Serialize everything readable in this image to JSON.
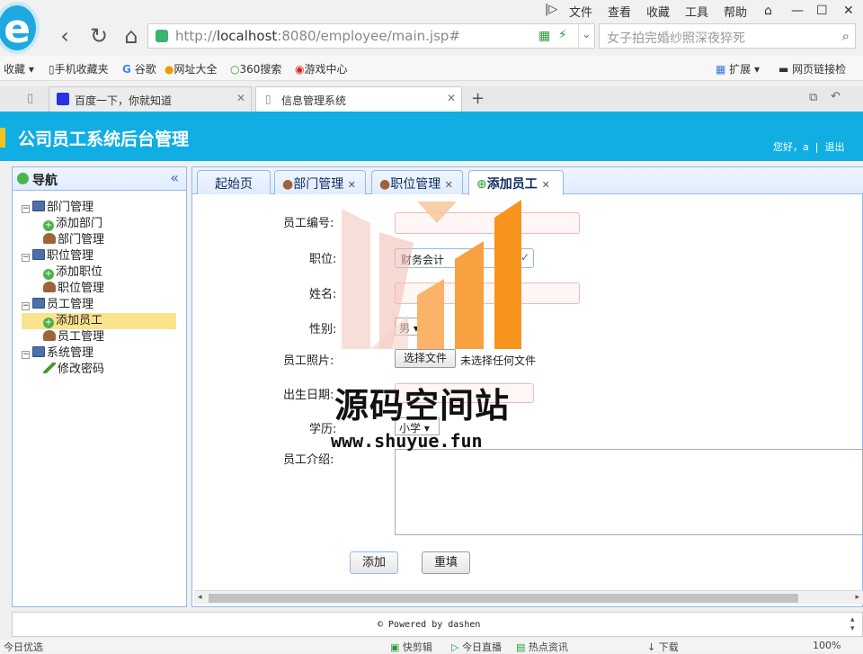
{
  "browser": {
    "url_prefix": "http://",
    "url_host": "localhost",
    "url_rest": ":8080/employee/main.jsp#",
    "search_placeholder": "女子拍完婚纱照深夜猝死",
    "menu": [
      "文件",
      "查看",
      "收藏",
      "工具",
      "帮助"
    ],
    "bookmarks": [
      "收藏",
      "手机收藏夹",
      "谷歌",
      "网址大全",
      "360搜索",
      "游戏中心"
    ],
    "bookmarks_right": [
      "扩展",
      "网页链接检"
    ],
    "tabs": [
      {
        "label": "百度一下，你就知道",
        "active": false
      },
      {
        "label": "信息管理系统",
        "active": true
      }
    ],
    "new_tab": "+"
  },
  "app": {
    "title": "公司员工系统后台管理",
    "greeting": "您好，a",
    "logout": "退出",
    "nav_title": "导航",
    "collapse_icon": "«",
    "tree": [
      {
        "label": "部门管理",
        "children": [
          {
            "label": "添加部门",
            "icon": "plus-icon"
          },
          {
            "label": "部门管理",
            "icon": "user-icon"
          }
        ]
      },
      {
        "label": "职位管理",
        "children": [
          {
            "label": "添加职位",
            "icon": "plus-icon"
          },
          {
            "label": "职位管理",
            "icon": "user-icon"
          }
        ]
      },
      {
        "label": "员工管理",
        "children": [
          {
            "label": "添加员工",
            "icon": "plus-icon",
            "selected": true
          },
          {
            "label": "员工管理",
            "icon": "user-icon"
          }
        ]
      },
      {
        "label": "系统管理",
        "children": [
          {
            "label": "修改密码",
            "icon": "pencil-icon"
          }
        ]
      }
    ],
    "tabs": [
      {
        "label": "起始页",
        "closable": false
      },
      {
        "label": "部门管理",
        "closable": true
      },
      {
        "label": "职位管理",
        "closable": true
      },
      {
        "label": "添加员工",
        "closable": true,
        "active": true
      }
    ],
    "form": {
      "emp_no_label": "员工编号:",
      "position_label": "职位:",
      "position_value": "财务会计",
      "name_label": "姓名:",
      "gender_label": "性别:",
      "gender_value": "男",
      "photo_label": "员工照片:",
      "file_button": "选择文件",
      "file_status": "未选择任何文件",
      "birth_label": "出生日期:",
      "edu_label": "学历:",
      "edu_value": "小学",
      "intro_label": "员工介绍:",
      "submit": "添加",
      "reset": "重填"
    },
    "footer": "© Powered by dashen"
  },
  "status": {
    "left": "今日优选",
    "zoom": "100%",
    "items": [
      "快剪辑",
      "今日直播",
      "热点资讯",
      "下载"
    ]
  },
  "watermark": {
    "text": "源码空间站",
    "url": "www.shuyue.fun"
  },
  "colors": {
    "header": "#11aee3",
    "panel_border": "#95b8e7",
    "selected": "#fbe38e",
    "wm_orange": "#f7941d"
  }
}
